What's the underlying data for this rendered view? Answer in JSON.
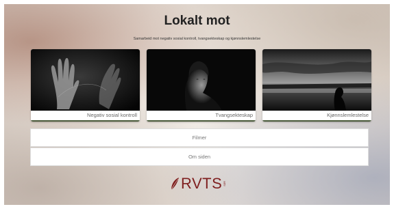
{
  "header": {
    "title": "Lokalt mot",
    "subtitle": "Samarbeid mot negativ sosial kontroll, tvangsekteskap og kjønnslemlestelse"
  },
  "cards": [
    {
      "label": "Negativ sosial kontroll",
      "image": "hands-icon"
    },
    {
      "label": "Tvangsekteskap",
      "image": "woman-portrait-icon"
    },
    {
      "label": "Kjønnslemlestelse",
      "image": "lake-silhouette-icon"
    }
  ],
  "menu": {
    "films": "Filmer",
    "about": "Om siden"
  },
  "logo": {
    "text": "RVTS",
    "region": "SØR"
  },
  "colors": {
    "accent": "#4a5a3a",
    "logo": "#7f1f1f"
  }
}
